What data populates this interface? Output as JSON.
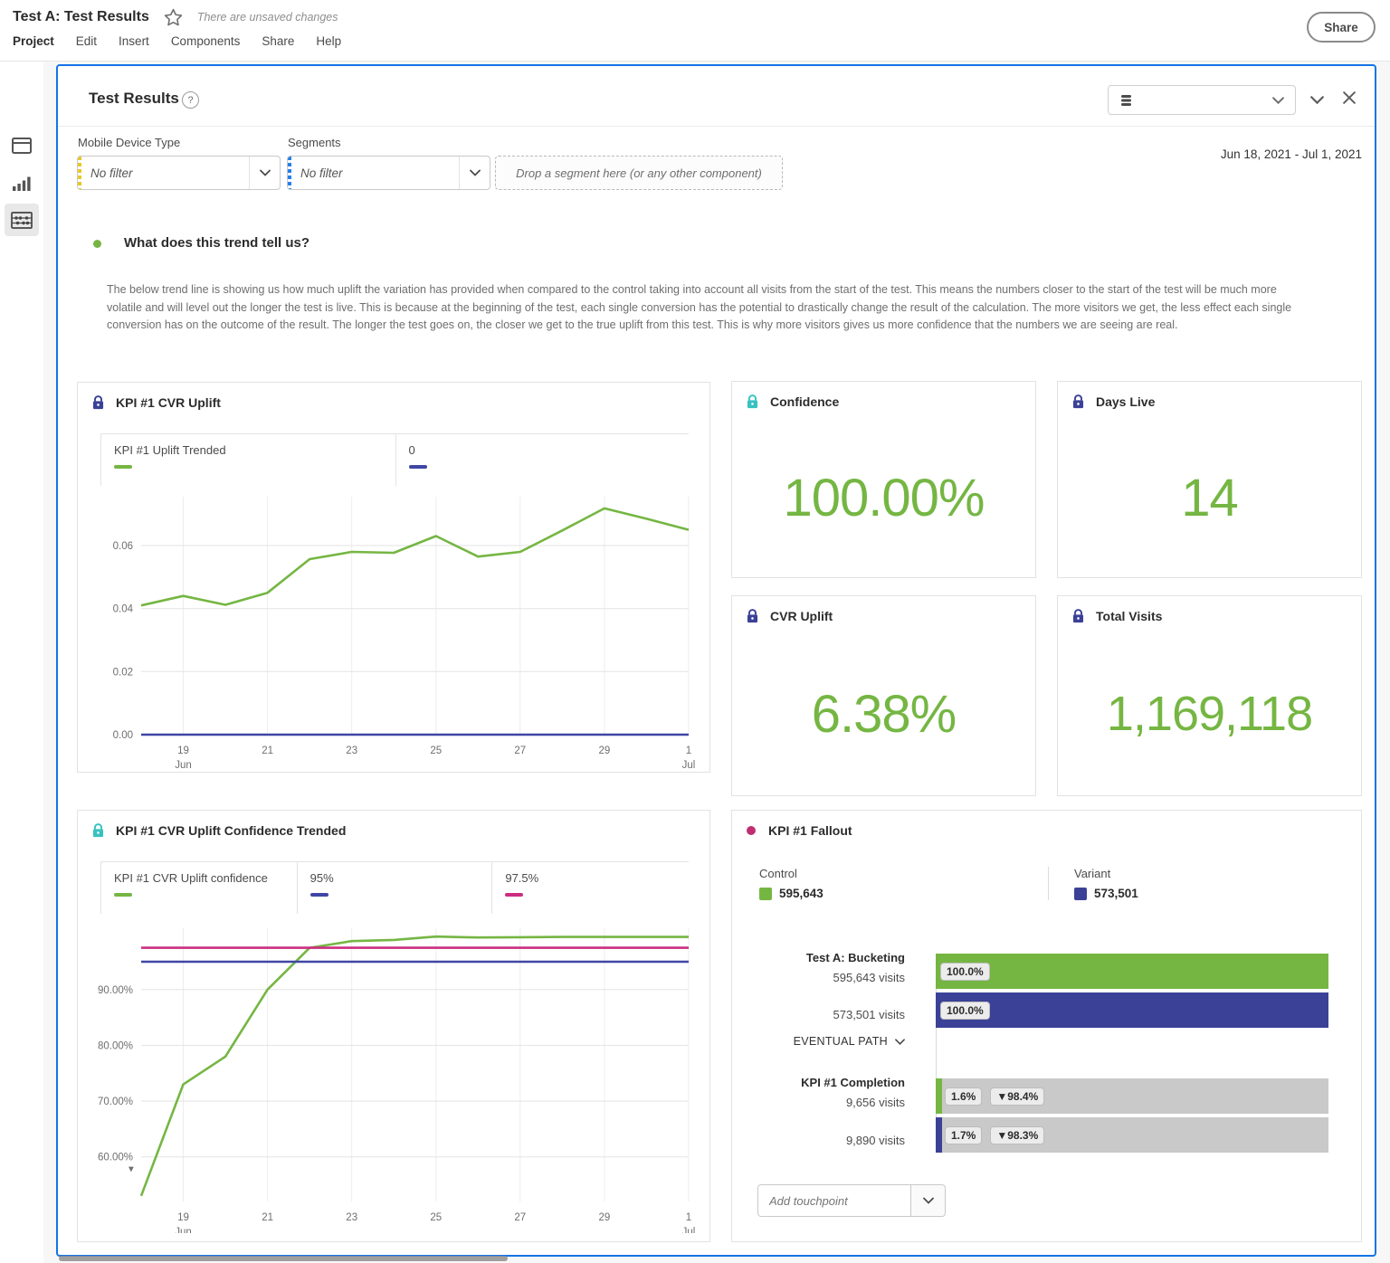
{
  "colors": {
    "accent_blue": "#1473e6",
    "green": "#75b643",
    "navy": "#3b4197",
    "magenta": "#cb2d80",
    "teal": "#38c1c1",
    "fallout_dot": "#bf2e72",
    "dropoff_gray": "#c9c9c9"
  },
  "app": {
    "title": "Test A: Test Results",
    "unsaved_notice": "There are unsaved changes",
    "menu": [
      "Project",
      "Edit",
      "Insert",
      "Components",
      "Share",
      "Help"
    ],
    "share_button": "Share"
  },
  "panel": {
    "title": "Test Results",
    "help_glyph": "?",
    "date_range": "Jun 18, 2021 - Jul 1, 2021",
    "filters": {
      "device_label": "Mobile Device Type",
      "device_value": "No filter",
      "segments_label": "Segments",
      "segments_value": "No filter",
      "dropzone_text": "Drop a segment here (or any other component)"
    }
  },
  "description": {
    "heading": "What does this trend tell us?",
    "body": "The below trend line is showing us how much uplift the variation has provided when compared to the control taking into account all visits from the start of the test. This means the numbers closer to the start of the test will be much more volatile and will level out the longer the test is live. This is because at the beginning of the test, each single conversion has the potential to drastically change the result of the calculation. The more visitors we get, the less effect each single conversion has on the outcome of the result. The longer the test goes on, the closer we get to the true uplift from this test. This is why more visitors gives us more confidence that the numbers we are seeing are real."
  },
  "cards": {
    "confidence": {
      "title": "Confidence",
      "value": "100.00%"
    },
    "days_live": {
      "title": "Days Live",
      "value": "14"
    },
    "cvr_uplift": {
      "title": "CVR Uplift",
      "value": "6.38%"
    },
    "total_visits": {
      "title": "Total Visits",
      "value": "1,169,118"
    }
  },
  "chart_data": [
    {
      "id": "kpi1-cvr-uplift",
      "type": "line",
      "title": "KPI #1 CVR Uplift",
      "x": [
        "Jun 18",
        "Jun 19",
        "Jun 20",
        "Jun 21",
        "Jun 22",
        "Jun 23",
        "Jun 24",
        "Jun 25",
        "Jun 26",
        "Jun 27",
        "Jun 28",
        "Jun 29",
        "Jun 30",
        "Jul 1"
      ],
      "series": [
        {
          "name": "KPI #1 Uplift Trended",
          "color": "#75b643",
          "values": [
            0.041,
            0.044,
            0.0412,
            0.045,
            0.0557,
            0.058,
            0.0577,
            0.063,
            0.0565,
            0.058,
            0.0648,
            0.0718,
            0.0685,
            0.065
          ]
        },
        {
          "name": "0",
          "color": "#3f46a5",
          "constant": 0
        }
      ],
      "ylim": [
        0,
        0.0755
      ],
      "yticks": [
        {
          "v": 0,
          "label": "0.00"
        },
        {
          "v": 0.02,
          "label": "0.02"
        },
        {
          "v": 0.04,
          "label": "0.04"
        },
        {
          "v": 0.06,
          "label": "0.06"
        }
      ],
      "xticks": [
        {
          "i": 1,
          "label": "19",
          "sub": "Jun"
        },
        {
          "i": 3,
          "label": "21"
        },
        {
          "i": 5,
          "label": "23"
        },
        {
          "i": 7,
          "label": "25"
        },
        {
          "i": 9,
          "label": "27"
        },
        {
          "i": 11,
          "label": "29"
        },
        {
          "i": 13,
          "label": "1",
          "sub": "Jul"
        }
      ],
      "grid": true,
      "legend_position": "top"
    },
    {
      "id": "kpi1-cvr-uplift-confidence",
      "type": "line",
      "title": "KPI #1 CVR Uplift Confidence Trended",
      "x": [
        "Jun 18",
        "Jun 19",
        "Jun 20",
        "Jun 21",
        "Jun 22",
        "Jun 23",
        "Jun 24",
        "Jun 25",
        "Jun 26",
        "Jun 27",
        "Jun 28",
        "Jun 29",
        "Jun 30",
        "Jul 1"
      ],
      "series": [
        {
          "name": "KPI #1 CVR Uplift confidence",
          "color": "#75b643",
          "values": [
            53,
            73,
            78,
            90,
            97.5,
            98.7,
            98.9,
            99.5,
            99.35,
            99.4,
            99.45,
            99.45,
            99.45,
            99.45
          ]
        },
        {
          "name": "95%",
          "color": "#3f46a5",
          "constant": 95
        },
        {
          "name": "97.5%",
          "color": "#cb2d80",
          "constant": 97.5
        }
      ],
      "ylim": [
        52,
        101
      ],
      "yticks": [
        {
          "v": 60,
          "label": "60.00%"
        },
        {
          "v": 70,
          "label": "70.00%"
        },
        {
          "v": 80,
          "label": "80.00%"
        },
        {
          "v": 90,
          "label": "90.00%"
        }
      ],
      "xticks": [
        {
          "i": 1,
          "label": "19",
          "sub": "Jun"
        },
        {
          "i": 3,
          "label": "21"
        },
        {
          "i": 5,
          "label": "23"
        },
        {
          "i": 7,
          "label": "25"
        },
        {
          "i": 9,
          "label": "27"
        },
        {
          "i": 11,
          "label": "29"
        },
        {
          "i": 13,
          "label": "1",
          "sub": "Jul"
        }
      ],
      "truncated_axis_marker": "▾",
      "grid": true,
      "legend_position": "top"
    },
    {
      "id": "kpi1-fallout",
      "type": "bar",
      "title": "KPI #1 Fallout",
      "groups": [
        "Control",
        "Variant"
      ],
      "group_totals": [
        595643,
        573501
      ],
      "steps": [
        {
          "name": "Test A: Bucketing",
          "control": {
            "visits": 595643,
            "pct": 100.0
          },
          "variant": {
            "visits": 573501,
            "pct": 100.0
          }
        },
        {
          "name": "KPI #1 Completion",
          "control": {
            "visits": 9656,
            "pct": 1.6,
            "dropoff_pct": 98.4
          },
          "variant": {
            "visits": 9890,
            "pct": 1.7,
            "dropoff_pct": 98.3
          }
        }
      ]
    }
  ],
  "fallout": {
    "title": "KPI #1 Fallout",
    "legend": [
      {
        "name": "Control",
        "value": "595,643",
        "color": "#75b643"
      },
      {
        "name": "Variant",
        "value": "573,501",
        "color": "#3b4197"
      }
    ],
    "eventual_path": "EVENTUAL PATH",
    "steps": [
      {
        "name": "Test A: Bucketing",
        "rows": [
          {
            "visits": "595,643 visits",
            "pct": "100.0%",
            "color": "#75b643"
          },
          {
            "visits": "573,501 visits",
            "pct": "100.0%",
            "color": "#3b4197"
          }
        ]
      },
      {
        "name": "KPI #1 Completion",
        "rows": [
          {
            "visits": "9,656 visits",
            "pct": "1.6%",
            "drop": "▼98.4%",
            "color": "#75b643"
          },
          {
            "visits": "9,890 visits",
            "pct": "1.7%",
            "drop": "▼98.3%",
            "color": "#3b4197"
          }
        ]
      }
    ],
    "add_touchpoint_placeholder": "Add touchpoint"
  }
}
